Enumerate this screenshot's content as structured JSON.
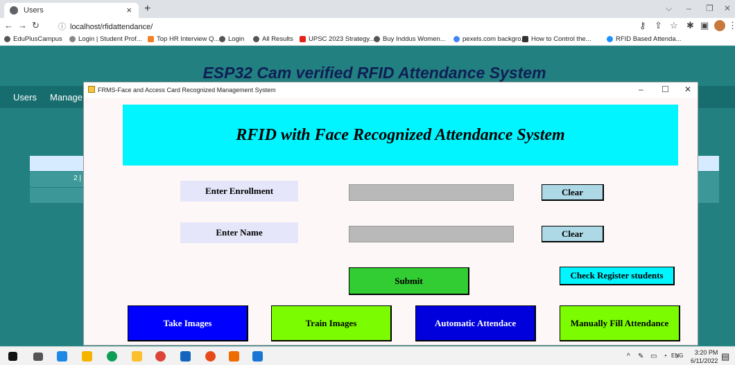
{
  "browser": {
    "tab_title": "Users",
    "tab_close": "×",
    "new_tab": "+",
    "url": "localhost/rfidattendance/",
    "bookmarks": [
      "EduPlusCampus",
      "Login | Student Prof...",
      "Top HR Interview Q...",
      "Login",
      "All Results",
      "UPSC 2023 Strategy...",
      "Buy Inddus Women...",
      "pexels.com backgro...",
      "How to Control the...",
      "RFID Based Attenda..."
    ]
  },
  "webpage": {
    "title": "ESP32 Cam verified RFID Attendance System",
    "nav_users": "Users",
    "nav_manage": "Manage U",
    "row_value": "2 |"
  },
  "app_window": {
    "title": "FRMS-Face and Access Card Recognized Management System",
    "minimize": "–",
    "maximize": "☐",
    "close": "✕",
    "banner": "RFID with Face Recognized Attendance System",
    "enrollment_label": "Enter Enrollment",
    "name_label": "Enter Name",
    "clear_label": "Clear",
    "submit_label": "Submit",
    "check_register_label": "Check Register students",
    "take_images_label": "Take Images",
    "train_images_label": "Train Images",
    "automatic_attendance_label": "Automatic Attendace",
    "manual_attendance_label": "Manually Fill Attendance",
    "enrollment_value": "",
    "name_value": ""
  },
  "colors": {
    "banner_bg": "#00f5ff",
    "take_images_bg": "#0000ff",
    "train_images_bg": "#7cfc00",
    "automatic_bg": "#0000dd",
    "manual_bg": "#7cfc00",
    "submit_bg": "#32cd32",
    "clear_bg": "#add8e6"
  },
  "taskbar": {
    "tray_lang": "ENG",
    "time": "3:20 PM",
    "date": "6/11/2022"
  }
}
